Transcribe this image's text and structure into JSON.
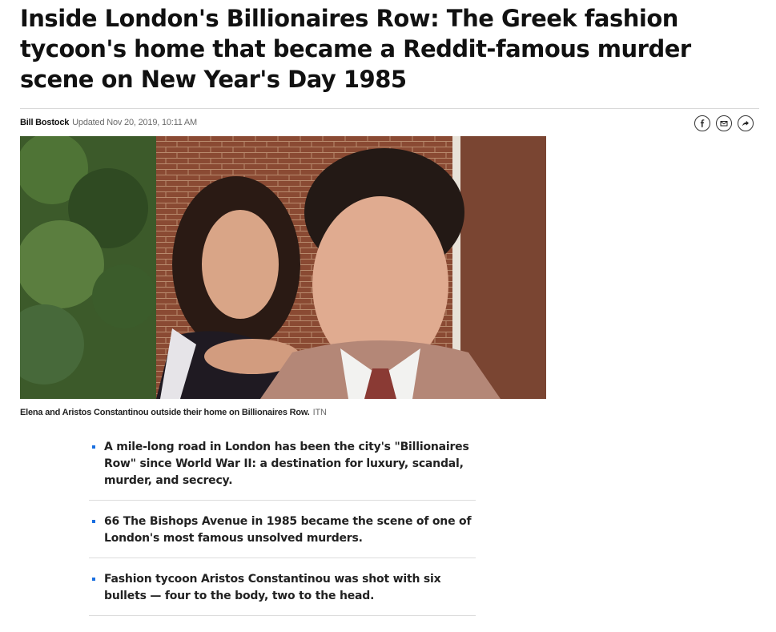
{
  "article": {
    "headline": "Inside London's Billionaires Row: The Greek fashion tycoon's home that became a Reddit-famous murder scene on New Year's Day 1985",
    "author": "Bill Bostock",
    "updated": "Updated Nov 20, 2019, 10:11 AM"
  },
  "share": {
    "icons": [
      "facebook-icon",
      "email-icon",
      "share-icon"
    ]
  },
  "photo": {
    "caption": "Elena and Aristos Constantinou outside their home on Billionaires Row.",
    "credit": "ITN"
  },
  "key_points": [
    "A mile-long road in London has been the city's \"Billionaires Row\" since World War II: a destination for luxury, scandal, murder, and secrecy.",
    "66 The Bishops Avenue in 1985 became the scene of one of London's most famous unsolved murders.",
    "Fashion tycoon Aristos Constantinou was shot with six bullets — four to the body, two to the head."
  ],
  "colors": {
    "bullet_accent": "#1a6fe0",
    "divider": "#dcdcdc"
  }
}
